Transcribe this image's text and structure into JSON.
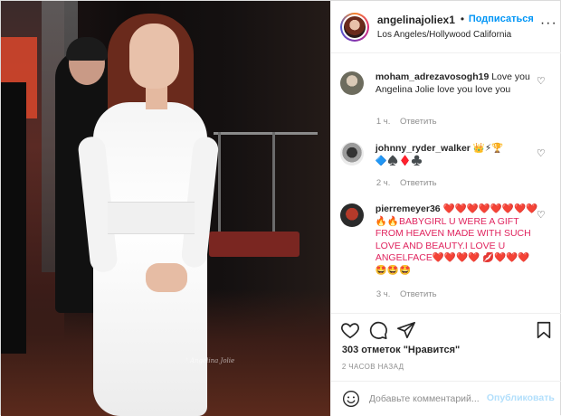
{
  "post": {
    "author": "angelinajoliex1",
    "follow_label": "Подписаться",
    "dot": "•",
    "location": "Los Angeles/Hollywood California",
    "more_label": "···",
    "photo_watermark": "ᵗ Angelina Jolie"
  },
  "comments": [
    {
      "username": "moham_adrezavosogh19",
      "text": "Love you Angelina Jolie love you love you",
      "time": "1 ч.",
      "reply_label": "Ответить"
    },
    {
      "username": "johnny_ryder_walker",
      "text": "👑⚡🏆 🔷♠️♦️♣️",
      "time": "2 ч.",
      "reply_label": "Ответить"
    },
    {
      "username": "pierremeyer36",
      "text": "❤️❤️❤️❤️❤️❤️❤️❤️🔥🔥BABYGIRL U WERE A GIFT FROM HEAVEN MADE WITH SUCH LOVE AND BEAUTY.I LOVE U ANGELFACE❤️❤️❤️❤️ 💋❤️❤️❤️🤩🤩🤩",
      "time": "3 ч.",
      "reply_label": "Ответить"
    }
  ],
  "actions": {
    "like_icon": "heart-icon",
    "comment_icon": "comment-icon",
    "share_icon": "share-icon",
    "save_icon": "bookmark-icon"
  },
  "likes_text": "303 отметок \"Нравится\"",
  "time_ago": "2 ЧАСОВ НАЗАД",
  "add_comment": {
    "placeholder": "Добавьте комментарий...",
    "publish_label": "Опубликовать"
  }
}
